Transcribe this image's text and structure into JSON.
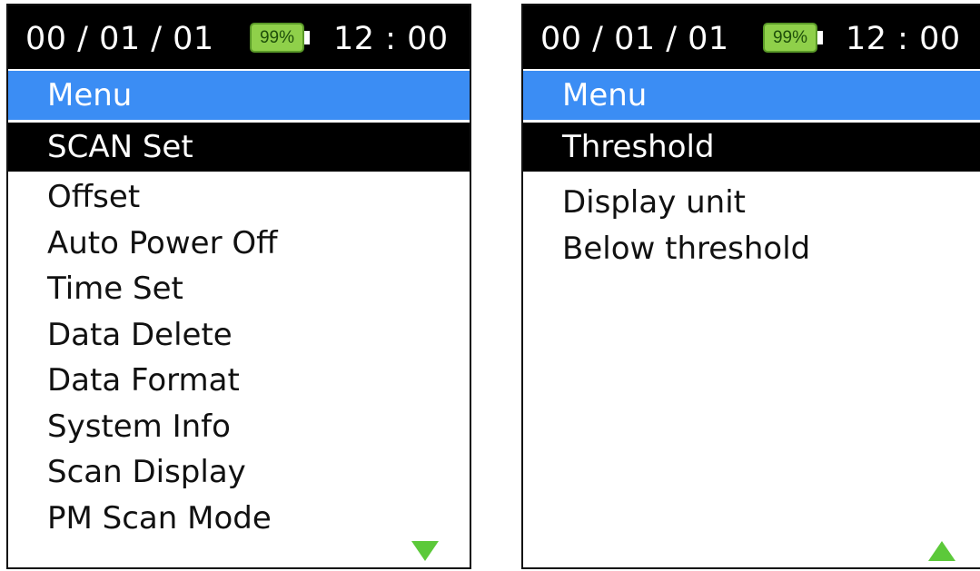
{
  "colors": {
    "status_bar": "#000000",
    "menu_header": "#3b8df4",
    "selected_item": "#000000",
    "battery": "#8fd04a",
    "arrow": "#5cc93a"
  },
  "left_screen": {
    "status": {
      "date": "00 / 01 / 01",
      "battery": "99%",
      "time": "12 : 00"
    },
    "header": "Menu",
    "selected": "SCAN Set",
    "items": [
      "Offset",
      "Auto Power Off",
      "Time Set",
      "Data Delete",
      "Data Format",
      "System Info",
      "Scan Display",
      "PM Scan Mode"
    ],
    "scroll_icon": "triangle-down-icon"
  },
  "right_screen": {
    "status": {
      "date": "00 / 01 / 01",
      "battery": "99%",
      "time": "12 : 00"
    },
    "header": "Menu",
    "selected": "Threshold",
    "items": [
      "Display unit",
      "Below threshold"
    ],
    "scroll_icon": "triangle-up-icon"
  }
}
